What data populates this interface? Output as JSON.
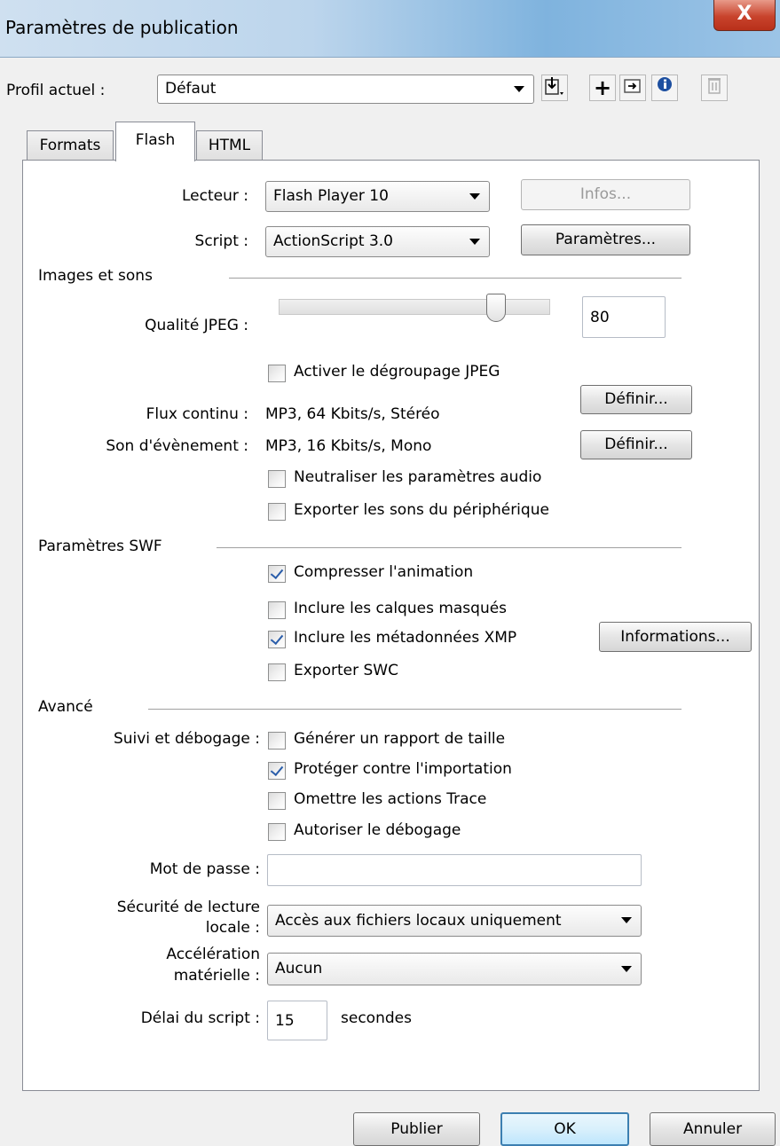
{
  "window": {
    "title": "Paramètres de publication",
    "close_glyph": "X"
  },
  "profile": {
    "label": "Profil actuel :",
    "value": "Défaut",
    "icons": [
      "import-export-icon",
      "add-icon",
      "duplicate-icon",
      "info-icon",
      "delete-icon"
    ]
  },
  "tabs": [
    {
      "label": "Formats",
      "active": false
    },
    {
      "label": "Flash",
      "active": true
    },
    {
      "label": "HTML",
      "active": false
    }
  ],
  "player": {
    "label": "Lecteur :",
    "value": "Flash Player 10",
    "info_button": "Infos..."
  },
  "script": {
    "label": "Script :",
    "value": "ActionScript 3.0",
    "settings_button": "Paramètres..."
  },
  "images_sons": {
    "heading": "Images et sons",
    "jpeg_quality_label": "Qualité JPEG :",
    "jpeg_quality_value": "80",
    "jpeg_quality_level": 0.8,
    "jpeg_deblocking": {
      "label": "Activer le dégroupage JPEG",
      "checked": false
    },
    "stream_label": "Flux continu :",
    "stream_value": "MP3, 64 Kbits/s, Stéréo",
    "stream_button": "Définir...",
    "event_label": "Son d'évènement :",
    "event_value": "MP3, 16 Kbits/s, Mono",
    "event_button": "Définir...",
    "override_audio": {
      "label": "Neutraliser les paramètres audio",
      "checked": false
    },
    "export_device_sounds": {
      "label": "Exporter les sons du périphérique",
      "checked": false
    }
  },
  "swf": {
    "heading": "Paramètres SWF",
    "compress": {
      "label": "Compresser l'animation",
      "checked": true
    },
    "hidden_layers": {
      "label": "Inclure les calques masqués",
      "checked": false
    },
    "xmp": {
      "label": "Inclure les métadonnées XMP",
      "checked": true
    },
    "info_button": "Informations...",
    "swc": {
      "label": "Exporter SWC",
      "checked": false
    }
  },
  "advanced": {
    "heading": "Avancé",
    "trace_label": "Suivi et débogage :",
    "size_report": {
      "label": "Générer un rapport de taille",
      "checked": false
    },
    "protect": {
      "label": "Protéger contre l'importation",
      "checked": true
    },
    "omit_trace": {
      "label": "Omettre les actions Trace",
      "checked": false
    },
    "debugging": {
      "label": "Autoriser le débogage",
      "checked": false
    },
    "password_label": "Mot de passe :",
    "password_value": "",
    "security_label_1": "Sécurité de lecture",
    "security_label_2": "locale :",
    "security_value": "Accès aux fichiers locaux uniquement",
    "accel_label_1": "Accélération",
    "accel_label_2": "matérielle :",
    "accel_value": "Aucun",
    "timeout_label": "Délai du script :",
    "timeout_value": "15",
    "timeout_unit": "secondes"
  },
  "footer": {
    "publish": "Publier",
    "ok": "OK",
    "cancel": "Annuler"
  }
}
